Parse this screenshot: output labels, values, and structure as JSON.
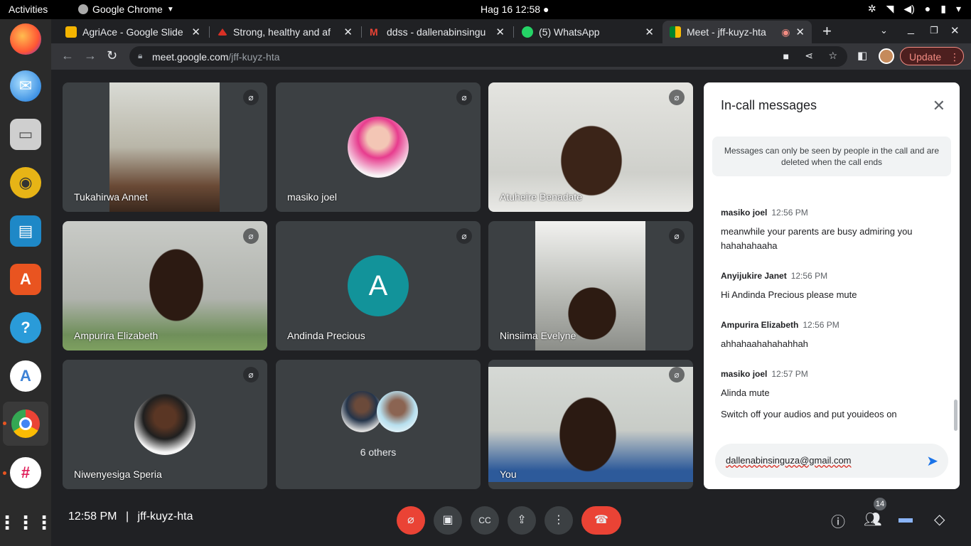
{
  "system": {
    "activities": "Activities",
    "app_name": "Google Chrome",
    "clock": "Hag 16  12:58"
  },
  "browser": {
    "tabs": [
      {
        "label": "AgriAce - Google Slide",
        "color": "#f4b400"
      },
      {
        "label": "Strong, healthy and af",
        "color": "#d93025"
      },
      {
        "label": "ddss - dallenabinsingu",
        "color": "#ea4335"
      },
      {
        "label": "(5) WhatsApp",
        "color": "#25d366"
      },
      {
        "label": "Meet - jff-kuyz-hta",
        "color": "#00832d"
      }
    ],
    "url_host": "meet.google.com",
    "url_path": "/jff-kuyz-hta",
    "update_label": "Update"
  },
  "tiles": [
    {
      "name": "Tukahirwa Annet"
    },
    {
      "name": "masiko joel"
    },
    {
      "name": "Atuheire Benadate"
    },
    {
      "name": "Ampurira Elizabeth"
    },
    {
      "name": "Andinda Precious",
      "initial": "A"
    },
    {
      "name": "Ninsiima Evelyne"
    },
    {
      "name": "Niwenyesiga Speria"
    },
    {
      "name": "",
      "others": "6 others"
    },
    {
      "name": "You"
    }
  ],
  "panel": {
    "title": "In-call messages",
    "notice": "Messages can only be seen by people in the call and are deleted when the call ends",
    "messages": [
      {
        "sender": "masiko joel",
        "time": "12:56 PM",
        "text": "meanwhile your parents are busy admiring you hahahahaaha"
      },
      {
        "sender": "Anyijukire Janet",
        "time": "12:56 PM",
        "text": "Hi Andinda Precious please mute"
      },
      {
        "sender": "Ampurira Elizabeth",
        "time": "12:56 PM",
        "text": "ahhahaahahahahhah"
      },
      {
        "sender": "masiko joel",
        "time": "12:57 PM",
        "text": "Alinda mute",
        "text2": "Switch off your audios and put youideos on"
      }
    ],
    "composer_text": "dallenabinsinguza@gmail.com"
  },
  "bottom": {
    "time": "12:58 PM",
    "divider": "|",
    "code": "jff-kuyz-hta",
    "participant_count": "14"
  },
  "colors": {
    "accent": "#1a73e8",
    "end_call": "#ea4335",
    "mic_off": "#ea4335",
    "update": "#f28b82"
  }
}
